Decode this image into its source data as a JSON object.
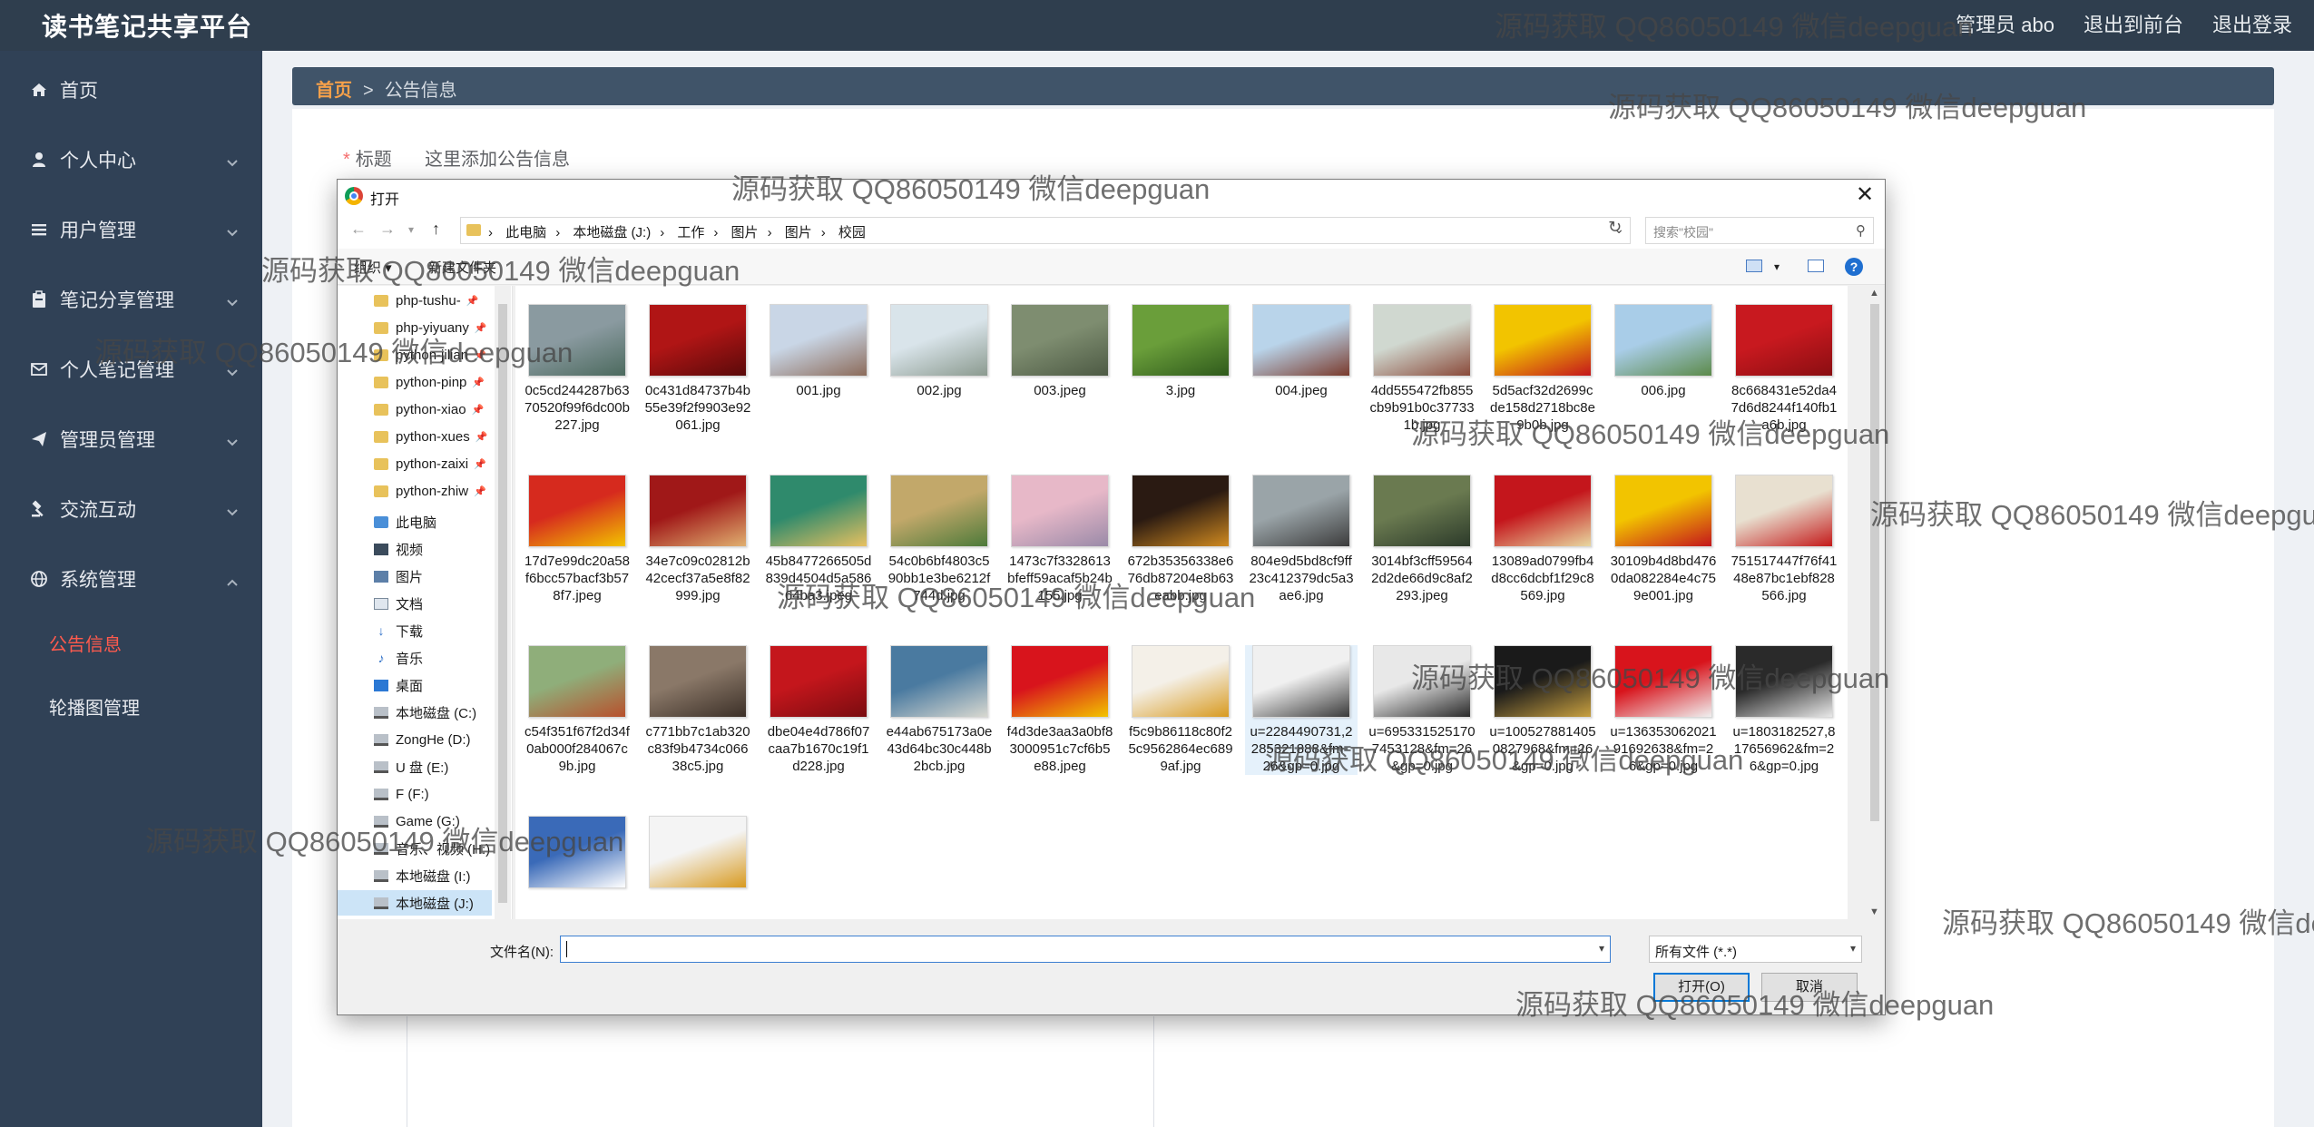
{
  "header": {
    "brand": "读书笔记共享平台",
    "user_text": "管理员 abo",
    "to_front": "退出到前台",
    "logout": "退出登录"
  },
  "sidebar": {
    "items": [
      {
        "label": "首页",
        "icon": "home-icon"
      },
      {
        "label": "个人中心",
        "icon": "user-icon"
      },
      {
        "label": "用户管理",
        "icon": "list-icon"
      },
      {
        "label": "笔记分享管理",
        "icon": "clipboard-icon"
      },
      {
        "label": "个人笔记管理",
        "icon": "mail-icon"
      },
      {
        "label": "管理员管理",
        "icon": "send-icon"
      },
      {
        "label": "交流互动",
        "icon": "gavel-icon"
      },
      {
        "label": "系统管理",
        "icon": "globe-icon"
      }
    ],
    "sub_items": [
      {
        "label": "公告信息",
        "active": true
      },
      {
        "label": "轮播图管理",
        "active": false
      }
    ]
  },
  "breadcrumb": {
    "home": "首页",
    "sep": ">",
    "current": "公告信息"
  },
  "form": {
    "required_mark": "*",
    "title_label": "标题",
    "title_placeholder": "这里添加公告信息"
  },
  "dialog": {
    "title": "打开",
    "close": "✕",
    "address": [
      "此电脑",
      "本地磁盘 (J:)",
      "工作",
      "图片",
      "图片",
      "校园"
    ],
    "search_placeholder": "搜索\"校园\"",
    "organize": "组织 ▾",
    "new_folder": "新建文件夹",
    "help": "?",
    "tree": [
      {
        "label": "php-tushu-",
        "icon": "folder",
        "pin": true
      },
      {
        "label": "php-yiyuany",
        "icon": "folder",
        "pin": true
      },
      {
        "label": "python-jilian",
        "icon": "folder",
        "pin": true
      },
      {
        "label": "python-pinp",
        "icon": "folder",
        "pin": true
      },
      {
        "label": "python-xiao",
        "icon": "folder",
        "pin": true
      },
      {
        "label": "python-xues",
        "icon": "folder",
        "pin": true
      },
      {
        "label": "python-zaixi",
        "icon": "folder",
        "pin": true
      },
      {
        "label": "python-zhiw",
        "icon": "folder",
        "pin": true
      },
      {
        "label": "此电脑",
        "icon": "pc",
        "pin": false
      },
      {
        "label": "视频",
        "icon": "video",
        "pin": false
      },
      {
        "label": "图片",
        "icon": "pic",
        "pin": false
      },
      {
        "label": "文档",
        "icon": "doc",
        "pin": false
      },
      {
        "label": "下载",
        "icon": "down",
        "pin": false
      },
      {
        "label": "音乐",
        "icon": "music",
        "pin": false
      },
      {
        "label": "桌面",
        "icon": "desk",
        "pin": false
      },
      {
        "label": "本地磁盘 (C:)",
        "icon": "drive",
        "pin": false
      },
      {
        "label": "ZongHe (D:)",
        "icon": "drive",
        "pin": false
      },
      {
        "label": "U 盘 (E:)",
        "icon": "drive",
        "pin": false
      },
      {
        "label": "F (F:)",
        "icon": "drive",
        "pin": false
      },
      {
        "label": "Game (G:)",
        "icon": "drive",
        "pin": false
      },
      {
        "label": "音乐、视频 (H:)",
        "icon": "drive",
        "pin": false
      },
      {
        "label": "本地磁盘 (I:)",
        "icon": "drive",
        "pin": false
      },
      {
        "label": "本地磁盘 (J:)",
        "icon": "drive",
        "pin": false,
        "selected": true
      }
    ],
    "files": [
      {
        "name": "0c5cd244287b6370520f99f6dc00b227.jpg",
        "c1": "#8a9aa0",
        "c2": "#4c6a5e"
      },
      {
        "name": "0c431d84737b4b55e39f2f9903e92061.jpg",
        "c1": "#b01515",
        "c2": "#5a0a0a"
      },
      {
        "name": "001.jpg",
        "c1": "#c9d6e6",
        "c2": "#8c6b5a"
      },
      {
        "name": "002.jpg",
        "c1": "#d9e4ea",
        "c2": "#8b9a8f"
      },
      {
        "name": "003.jpeg",
        "c1": "#7e8d70",
        "c2": "#4d5a44"
      },
      {
        "name": "3.jpg",
        "c1": "#6a9e3a",
        "c2": "#2f5a1c"
      },
      {
        "name": "004.jpeg",
        "c1": "#b9d4ea",
        "c2": "#7a3a2c"
      },
      {
        "name": "4dd555472fb855cb9b91b0c377331b.jpg",
        "c1": "#d0d8d0",
        "c2": "#8a4a3a"
      },
      {
        "name": "5d5acf32d2699cde158d2718bc8e9b0b.jpg",
        "c1": "#f2c400",
        "c2": "#c4161c"
      },
      {
        "name": "006.jpg",
        "c1": "#a9cde8",
        "c2": "#5c8a4a"
      },
      {
        "name": "8c668431e52da47d6d8244f140fb1a6b.jpg",
        "c1": "#c8191f",
        "c2": "#8a0e12"
      },
      {
        "name": "17d7e99dc20a58f6bcc57bacf3b578f7.jpeg",
        "c1": "#d62a1e",
        "c2": "#f2c400"
      },
      {
        "name": "34e7c09c02812b42cecf37a5e8f82999.jpg",
        "c1": "#a01818",
        "c2": "#e0b070"
      },
      {
        "name": "45b8477266505d839d4504d5a58664ba3.jpeg",
        "c1": "#2f8a6c",
        "c2": "#e8c060"
      },
      {
        "name": "54c0b6bf4803c590bb1e3be6212f744d.jpg",
        "c1": "#c2a86a",
        "c2": "#4d7a3a"
      },
      {
        "name": "1473c7f3328613bfeff59acaf5b24b155.jpg",
        "c1": "#e7b8c8",
        "c2": "#9a8aa8"
      },
      {
        "name": "672b35356338e676db87204e8b63eabb.jpg",
        "c1": "#2a1a12",
        "c2": "#d08a20"
      },
      {
        "name": "804e9d5bd8cf9ff23c412379dc5a3ae6.jpg",
        "c1": "#9aa4a8",
        "c2": "#3c3c3c"
      },
      {
        "name": "3014bf3cff595642d2de66d9c8af2293.jpeg",
        "c1": "#6a7a50",
        "c2": "#2c3a2a"
      },
      {
        "name": "13089ad0799fb4d8cc6dcbf1f29c8569.jpg",
        "c1": "#c4161c",
        "c2": "#e8d8a0"
      },
      {
        "name": "30109b4d8bd4760da082284e4c759e001.jpg",
        "c1": "#f2c400",
        "c2": "#c4161c"
      },
      {
        "name": "751517447f76f4148e87bc1ebf828566.jpg",
        "c1": "#e8e0d0",
        "c2": "#c41a1a"
      },
      {
        "name": "c54f351f67f2d34f0ab000f284067c9b.jpg",
        "c1": "#8fae7a",
        "c2": "#b8502c"
      },
      {
        "name": "c771bb7c1ab320c83f9b4734c06638c5.jpg",
        "c1": "#8a7868",
        "c2": "#3c3028"
      },
      {
        "name": "dbe04e4d786f07caa7b1670c19f1d228.jpg",
        "c1": "#c4161c",
        "c2": "#7a0c10"
      },
      {
        "name": "e44ab675173a0e43d64bc30c448b2bcb.jpg",
        "c1": "#4a7aa0",
        "c2": "#d8d8d0"
      },
      {
        "name": "f4d3de3aa3a0bf83000951c7cf6b5e88.jpeg",
        "c1": "#d8141c",
        "c2": "#f2c400"
      },
      {
        "name": "f5c9b86118c80f25c9562864ec6899af.jpg",
        "c1": "#f4f0e8",
        "c2": "#d89a20"
      },
      {
        "name": "u=2284490731,2285321888&fm=26&gp=0.jpg",
        "c1": "#f0f0f0",
        "c2": "#3a3a3a",
        "selected": true
      },
      {
        "name": "u=6953315251707453128&fm=26&gp=0.jpg",
        "c1": "#e8e8e8",
        "c2": "#2a2a2a"
      },
      {
        "name": "u=1005278814050827968&fm=26&gp=0.jpg",
        "c1": "#1a1a1a",
        "c2": "#c8a040"
      },
      {
        "name": "u=13635306202191692638&fm=26&gp=0.jpg",
        "c1": "#d8141c",
        "c2": "#f0f0f0"
      },
      {
        "name": "u=1803182527,817656962&fm=26&gp=0.jpg",
        "c1": "#2a2a2a",
        "c2": "#e8e8e8"
      },
      {
        "name": "",
        "c1": "#3a6ab8",
        "c2": "#ffffff"
      },
      {
        "name": "",
        "c1": "#f4f4f4",
        "c2": "#d89a20"
      }
    ],
    "file_name_label": "文件名(N):",
    "file_name_value": "",
    "file_type": "所有文件 (*.*)",
    "open": "打开(O)",
    "cancel": "取消"
  },
  "watermark": "源码获取 QQ86050149 微信deepguan"
}
